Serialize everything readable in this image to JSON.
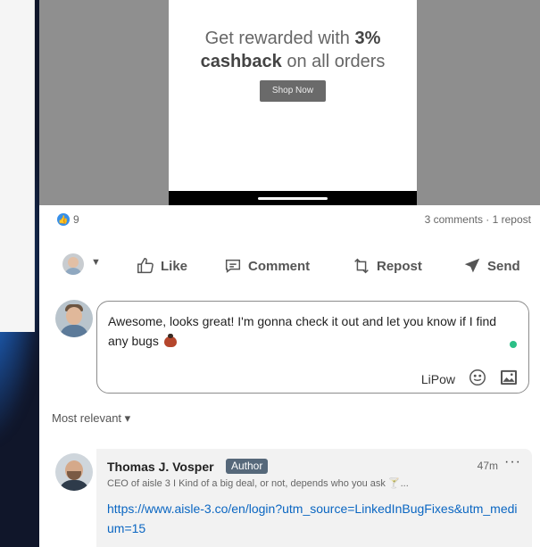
{
  "ad": {
    "line1_prefix": "Get rewarded with ",
    "line1_bold": "3%",
    "line2_bold": "cashback",
    "line2_rest": " on all orders",
    "button": "Shop Now"
  },
  "social": {
    "reactions": "9",
    "summary": "3 comments · 1 repost"
  },
  "actions": {
    "like": "Like",
    "comment": "Comment",
    "repost": "Repost",
    "send": "Send"
  },
  "composer": {
    "text": "Awesome, looks great! I'm gonna check it out and let you know if I find any bugs",
    "brand": "LiPow"
  },
  "sort": {
    "label": "Most relevant ▾"
  },
  "comment": {
    "author": "Thomas J. Vosper",
    "badge": "Author",
    "time": "47m",
    "more": "···",
    "headline": "CEO of aisle 3 I Kind of a big deal, or not, depends who you ask 🍸...",
    "link": "https://www.aisle-3.co/en/login?utm_source=LinkedInBugFixes&utm_medium=15"
  },
  "colors": {
    "link": "#0a66c2",
    "like_blue": "#378fe9",
    "online_green": "#2bbf86",
    "author_badge": "#56687a"
  }
}
